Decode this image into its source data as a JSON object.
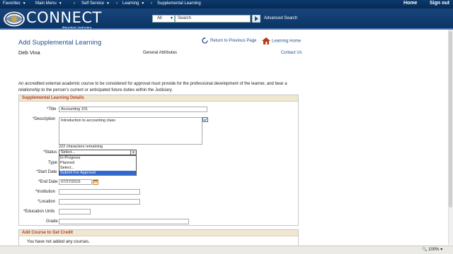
{
  "topnav": {
    "favorites": "Favorites",
    "main_menu": "Main Menu",
    "sep1": "›",
    "self_service": "Self Service",
    "sep2": "›",
    "learning": "Learning",
    "sep3": "›",
    "current": "Supplemental Learning",
    "home": "Home",
    "sign_out": "Sign out"
  },
  "brand": {
    "logo_text": "CONNECT",
    "logo_sub": "Maryland Judiciary"
  },
  "search": {
    "scope": "All",
    "placeholder": "Search",
    "advanced": "Advanced Search"
  },
  "page": {
    "title": "Add Supplemental Learning",
    "user": "Deb Vina",
    "general": "General Attributes",
    "return_link": "Return to Previous Page",
    "home_link": "Learning Home",
    "contact": "Contact Us",
    "intro": "An accredited external academic course to be considered for approval must provide for the professional development of the learner, and bear a relationship to the person's current or anticipated future duties within the Judiciary."
  },
  "details": {
    "header": "Supplemental Learning Details",
    "title_label": "*Title",
    "title_value": "Accounting 101",
    "desc_label": "*Description",
    "desc_value": "Introduction to accounting class",
    "remaining": "222 characters remaining",
    "status_label": "*Status",
    "status_value": "Select...",
    "status_options": [
      "In-Progress",
      "Planned",
      "Select...",
      "Submit For Approval"
    ],
    "type_label": "Type",
    "start_label": "*Start Date",
    "end_label": "*End Date",
    "end_value": "07/27/2015",
    "institution_label": "*Institution",
    "location_label": "*Location",
    "units_label": "*Education Units",
    "grade_label": "Grade"
  },
  "courses": {
    "header": "Add Course to Get Credit",
    "empty": "You have not added any courses."
  },
  "statusbar": {
    "zoom": "100%"
  }
}
